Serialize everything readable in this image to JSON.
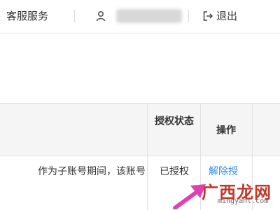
{
  "header": {
    "service_label": "客服服务",
    "user_icon": "user-icon",
    "logout_icon": "logout-icon",
    "logout_label": "退出"
  },
  "table": {
    "headers": {
      "auth_status": "授权状态",
      "action": "操作"
    },
    "rows": [
      {
        "description": "作为子账号期间，该账号",
        "status": "已授权",
        "action": "解除授"
      }
    ]
  },
  "watermark": {
    "logo_text": "广西龙网",
    "url": "mingyanl.com"
  },
  "colors": {
    "link": "#2d8cf0",
    "header_bg": "#f5f5f5",
    "arrow": "#e040b0",
    "watermark": "#c0392b"
  }
}
